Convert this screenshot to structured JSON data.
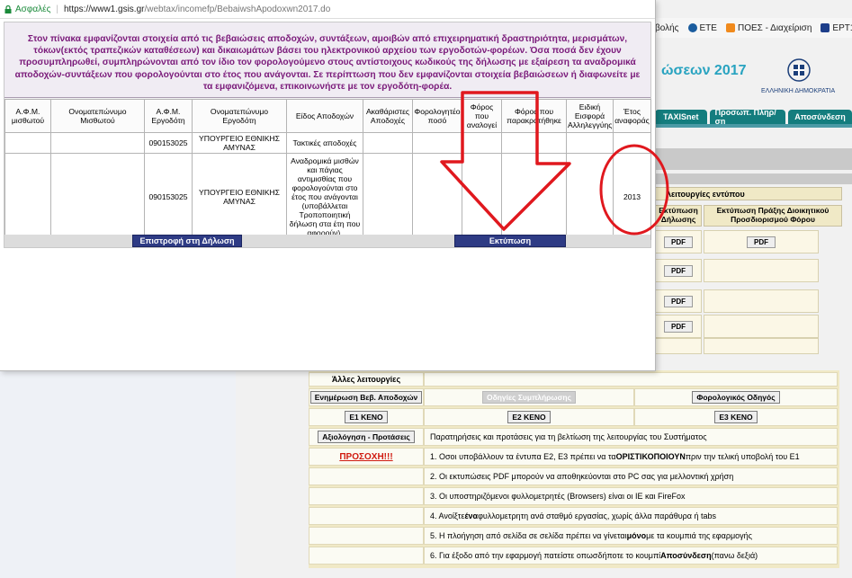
{
  "browser": {
    "secure_label": "Ασφαλές",
    "url_host": "https://www1.gsis.gr",
    "url_path": "/webtax/incomefp/BebaiwshApodoxwn2017.do"
  },
  "bookmarks": [
    {
      "label": "βολής",
      "color": "#ffffff"
    },
    {
      "label": "ETE",
      "color": "#1a5c9e"
    },
    {
      "label": "ΠΟΕΣ - Διαχείριση",
      "color": "#f08a1d"
    },
    {
      "label": "ΕΡΤ1",
      "color": "#1d3e8a"
    }
  ],
  "background": {
    "page_title": "ώσεων 2017",
    "emblem_label": "ΕΛΛΗΝΙΚΗ ΔΗΜΟΚΡΑΤΙΑ",
    "tabs": [
      "TAXISnet",
      "Προσωπ. Πληρ/ση",
      "Αποσύνδεση"
    ],
    "print_header": "λειτουργίες εντύπου",
    "col_print_cert": "Εκτύπωση Δήλωσης",
    "col_print_act": "Εκτύπωση Πράξης Διοικητικού Προσδιορισμού Φόρου",
    "pdf_label": "PDF",
    "other_functions_title": "Άλλες λειτουργίες",
    "btn_update_certs": "Ενημέρωση Βεβ. Αποδοχών",
    "btn_guide_faded": "Οδηγίες Συμπλήρωσης",
    "btn_tax_guide": "Φορολογικός Οδηγός",
    "btn_e1_blank": "Ε1 ΚΕΝΟ",
    "btn_e2_blank": "Ε2 ΚΕΝΟ",
    "btn_e3_blank": "Ε3 ΚΕΝΟ",
    "btn_evaluation": "Αξιολόγηση - Προτάσεις",
    "evaluation_note": "Παρατηρήσεις και προτάσεις για τη βελτίωση της λειτουργίας του Συστήματος",
    "warning_label": "ΠΡΟΣΟΧΗ!!!",
    "notes": [
      {
        "pre": "1. Οσοι υποβάλλουν τα έντυπα Ε2, Ε3 πρέπει να τα ",
        "bold": "ΟΡΙΣΤΙΚΟΠΟΙΟΥΝ",
        "post": " πριν την τελική υποβολή του Ε1"
      },
      {
        "pre": "2. Οι εκτυπώσεις PDF μπορούν να αποθηκεύονται στο PC σας για μελλοντική χρήση",
        "bold": "",
        "post": ""
      },
      {
        "pre": "3. Οι υποστηριζόμενοι φυλλομετρητές (Browsers) είναι οι IE και FireFox",
        "bold": "",
        "post": ""
      },
      {
        "pre": "4. Ανοίξτε ",
        "bold": "ένα",
        "post": " φυλλομετρητη ανά σταθμό εργασίας, χωρίς άλλα παράθυρα ή tabs"
      },
      {
        "pre": "5. Η πλοήγηση από σελίδα σε σελίδα πρέπει να γίνεται ",
        "bold": "μόνο",
        "post": " με τα κουμπιά της εφαρμογής"
      },
      {
        "pre": "6. Για έξοδο από την εφαρμογή πατείστε οπωσδήποτε το κουμπί ",
        "bold": "Αποσύνδεση",
        "post": " (πανω δεξιά)"
      }
    ]
  },
  "notice": "Στον πίνακα εμφανίζονται στοιχεία από τις βεβαιώσεις αποδοχών, συντάξεων, αμοιβών από επιχειρηματική δραστηριότητα, μερισμάτων, τόκων(εκτός τραπεζικών καταθέσεων) και δικαιωμάτων βάσει του ηλεκτρονικού αρχείου των εργοδοτών-φορέων. Όσα ποσά δεν έχουν προσυμπληρωθεί, συμπληρώνονται από τον ίδιο τον φορολογούμενο στους αντίστοιχους κωδικούς της δήλωσης με εξαίρεση τα αναδρομικά αποδοχών-συντάξεων που φορολογούνται στο έτος που ανάγονται. Σε περίπτωση που δεν εμφανίζονται στοιχεία βεβαιώσεων ή διαφωνείτε με τα εμφανιζόμενα, επικοινωνήστε με τον εργοδότη-φορέα.",
  "table": {
    "headers": [
      "Α.Φ.Μ. μισθωτού",
      "Ονοματεπώνυμο Μισθωτού",
      "Α.Φ.Μ. Εργοδότη",
      "Ονοματεπώνυμο Εργοδότη",
      "Είδος Αποδοχών",
      "Ακαθάριστες Αποδοχές",
      "Φορολογητέο ποσό",
      "Φόρος που αναλογεί",
      "Φόρος που παρακρατήθηκε",
      "Ειδική Εισφορά Αλληλεγγύης",
      "Έτος αναφοράς"
    ],
    "rows": [
      [
        "",
        "",
        "090153025",
        "ΥΠΟΥΡΓΕΙΟ ΕΘΝΙΚΗΣ ΑΜΥΝΑΣ",
        "Τακτικές αποδοχές",
        "",
        "",
        "",
        "",
        "",
        ""
      ],
      [
        "",
        "",
        "090153025",
        "ΥΠΟΥΡΓΕΙΟ ΕΘΝΙΚΗΣ ΑΜΥΝΑΣ",
        "Αναδρομικά μισθών και πάγιας αντιμισθίας που φορολογούνται στο έτος που ανάγονται (υποβάλλεται Τροποποιητική δήλωση στα έτη που αφορούν).",
        "",
        "",
        "",
        "",
        "",
        "2013"
      ]
    ]
  },
  "actions": {
    "return_label": "Επιστροφή στη Δήλωση",
    "print_label": "Εκτύπωση"
  },
  "colors": {
    "notice_text": "#7a1a7a",
    "action_button": "#2e3b84",
    "annotation": "#e0181e"
  }
}
